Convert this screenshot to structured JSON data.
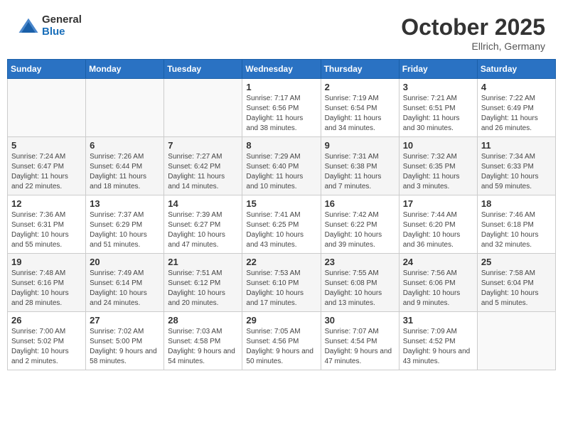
{
  "header": {
    "logo_general": "General",
    "logo_blue": "Blue",
    "month_title": "October 2025",
    "subtitle": "Ellrich, Germany"
  },
  "weekdays": [
    "Sunday",
    "Monday",
    "Tuesday",
    "Wednesday",
    "Thursday",
    "Friday",
    "Saturday"
  ],
  "weeks": [
    [
      {
        "day": "",
        "sunrise": "",
        "sunset": "",
        "daylight": ""
      },
      {
        "day": "",
        "sunrise": "",
        "sunset": "",
        "daylight": ""
      },
      {
        "day": "",
        "sunrise": "",
        "sunset": "",
        "daylight": ""
      },
      {
        "day": "1",
        "sunrise": "Sunrise: 7:17 AM",
        "sunset": "Sunset: 6:56 PM",
        "daylight": "Daylight: 11 hours and 38 minutes."
      },
      {
        "day": "2",
        "sunrise": "Sunrise: 7:19 AM",
        "sunset": "Sunset: 6:54 PM",
        "daylight": "Daylight: 11 hours and 34 minutes."
      },
      {
        "day": "3",
        "sunrise": "Sunrise: 7:21 AM",
        "sunset": "Sunset: 6:51 PM",
        "daylight": "Daylight: 11 hours and 30 minutes."
      },
      {
        "day": "4",
        "sunrise": "Sunrise: 7:22 AM",
        "sunset": "Sunset: 6:49 PM",
        "daylight": "Daylight: 11 hours and 26 minutes."
      }
    ],
    [
      {
        "day": "5",
        "sunrise": "Sunrise: 7:24 AM",
        "sunset": "Sunset: 6:47 PM",
        "daylight": "Daylight: 11 hours and 22 minutes."
      },
      {
        "day": "6",
        "sunrise": "Sunrise: 7:26 AM",
        "sunset": "Sunset: 6:44 PM",
        "daylight": "Daylight: 11 hours and 18 minutes."
      },
      {
        "day": "7",
        "sunrise": "Sunrise: 7:27 AM",
        "sunset": "Sunset: 6:42 PM",
        "daylight": "Daylight: 11 hours and 14 minutes."
      },
      {
        "day": "8",
        "sunrise": "Sunrise: 7:29 AM",
        "sunset": "Sunset: 6:40 PM",
        "daylight": "Daylight: 11 hours and 10 minutes."
      },
      {
        "day": "9",
        "sunrise": "Sunrise: 7:31 AM",
        "sunset": "Sunset: 6:38 PM",
        "daylight": "Daylight: 11 hours and 7 minutes."
      },
      {
        "day": "10",
        "sunrise": "Sunrise: 7:32 AM",
        "sunset": "Sunset: 6:35 PM",
        "daylight": "Daylight: 11 hours and 3 minutes."
      },
      {
        "day": "11",
        "sunrise": "Sunrise: 7:34 AM",
        "sunset": "Sunset: 6:33 PM",
        "daylight": "Daylight: 10 hours and 59 minutes."
      }
    ],
    [
      {
        "day": "12",
        "sunrise": "Sunrise: 7:36 AM",
        "sunset": "Sunset: 6:31 PM",
        "daylight": "Daylight: 10 hours and 55 minutes."
      },
      {
        "day": "13",
        "sunrise": "Sunrise: 7:37 AM",
        "sunset": "Sunset: 6:29 PM",
        "daylight": "Daylight: 10 hours and 51 minutes."
      },
      {
        "day": "14",
        "sunrise": "Sunrise: 7:39 AM",
        "sunset": "Sunset: 6:27 PM",
        "daylight": "Daylight: 10 hours and 47 minutes."
      },
      {
        "day": "15",
        "sunrise": "Sunrise: 7:41 AM",
        "sunset": "Sunset: 6:25 PM",
        "daylight": "Daylight: 10 hours and 43 minutes."
      },
      {
        "day": "16",
        "sunrise": "Sunrise: 7:42 AM",
        "sunset": "Sunset: 6:22 PM",
        "daylight": "Daylight: 10 hours and 39 minutes."
      },
      {
        "day": "17",
        "sunrise": "Sunrise: 7:44 AM",
        "sunset": "Sunset: 6:20 PM",
        "daylight": "Daylight: 10 hours and 36 minutes."
      },
      {
        "day": "18",
        "sunrise": "Sunrise: 7:46 AM",
        "sunset": "Sunset: 6:18 PM",
        "daylight": "Daylight: 10 hours and 32 minutes."
      }
    ],
    [
      {
        "day": "19",
        "sunrise": "Sunrise: 7:48 AM",
        "sunset": "Sunset: 6:16 PM",
        "daylight": "Daylight: 10 hours and 28 minutes."
      },
      {
        "day": "20",
        "sunrise": "Sunrise: 7:49 AM",
        "sunset": "Sunset: 6:14 PM",
        "daylight": "Daylight: 10 hours and 24 minutes."
      },
      {
        "day": "21",
        "sunrise": "Sunrise: 7:51 AM",
        "sunset": "Sunset: 6:12 PM",
        "daylight": "Daylight: 10 hours and 20 minutes."
      },
      {
        "day": "22",
        "sunrise": "Sunrise: 7:53 AM",
        "sunset": "Sunset: 6:10 PM",
        "daylight": "Daylight: 10 hours and 17 minutes."
      },
      {
        "day": "23",
        "sunrise": "Sunrise: 7:55 AM",
        "sunset": "Sunset: 6:08 PM",
        "daylight": "Daylight: 10 hours and 13 minutes."
      },
      {
        "day": "24",
        "sunrise": "Sunrise: 7:56 AM",
        "sunset": "Sunset: 6:06 PM",
        "daylight": "Daylight: 10 hours and 9 minutes."
      },
      {
        "day": "25",
        "sunrise": "Sunrise: 7:58 AM",
        "sunset": "Sunset: 6:04 PM",
        "daylight": "Daylight: 10 hours and 5 minutes."
      }
    ],
    [
      {
        "day": "26",
        "sunrise": "Sunrise: 7:00 AM",
        "sunset": "Sunset: 5:02 PM",
        "daylight": "Daylight: 10 hours and 2 minutes."
      },
      {
        "day": "27",
        "sunrise": "Sunrise: 7:02 AM",
        "sunset": "Sunset: 5:00 PM",
        "daylight": "Daylight: 9 hours and 58 minutes."
      },
      {
        "day": "28",
        "sunrise": "Sunrise: 7:03 AM",
        "sunset": "Sunset: 4:58 PM",
        "daylight": "Daylight: 9 hours and 54 minutes."
      },
      {
        "day": "29",
        "sunrise": "Sunrise: 7:05 AM",
        "sunset": "Sunset: 4:56 PM",
        "daylight": "Daylight: 9 hours and 50 minutes."
      },
      {
        "day": "30",
        "sunrise": "Sunrise: 7:07 AM",
        "sunset": "Sunset: 4:54 PM",
        "daylight": "Daylight: 9 hours and 47 minutes."
      },
      {
        "day": "31",
        "sunrise": "Sunrise: 7:09 AM",
        "sunset": "Sunset: 4:52 PM",
        "daylight": "Daylight: 9 hours and 43 minutes."
      },
      {
        "day": "",
        "sunrise": "",
        "sunset": "",
        "daylight": ""
      }
    ]
  ]
}
